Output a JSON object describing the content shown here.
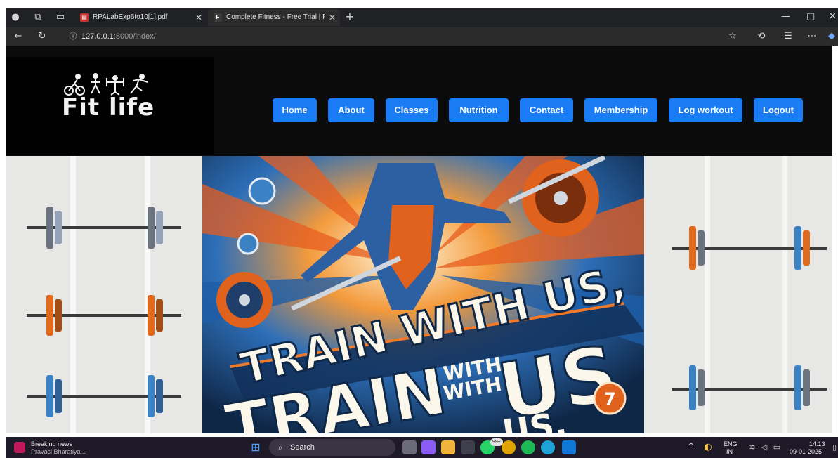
{
  "browser": {
    "tabs": [
      {
        "title": "RPALabExp6to10[1].pdf",
        "icon": "pdf-icon",
        "active": false
      },
      {
        "title": "Complete Fitness - Free Trial | Fo",
        "icon": "site-favicon",
        "active": true
      }
    ],
    "favicon_letter": "F",
    "url_host": "127.0.0.1",
    "url_rest": ":8000/index/"
  },
  "site": {
    "logo_text": "Fit life",
    "nav": [
      "Home",
      "About",
      "Classes",
      "Nutrition",
      "Contact",
      "Membership",
      "Log workout",
      "Logout"
    ],
    "colors": {
      "nav_button": "#1a7cf5",
      "header_bg": "#0b0b0b"
    }
  },
  "hero": {
    "line1": "TRAIN WITH US,",
    "line2a": "TRAIN",
    "line2b": "WITH",
    "line2c": "WITH",
    "line2d": "US",
    "badge": "7",
    "line3": "US,"
  },
  "taskbar": {
    "news_title": "Breaking news",
    "news_sub": "Pravasi Bharatiya...",
    "search_placeholder": "Search",
    "lang": "ENG",
    "region": "IN",
    "time": "14:13",
    "date": "09-01-2025",
    "badge_count": "99+"
  }
}
